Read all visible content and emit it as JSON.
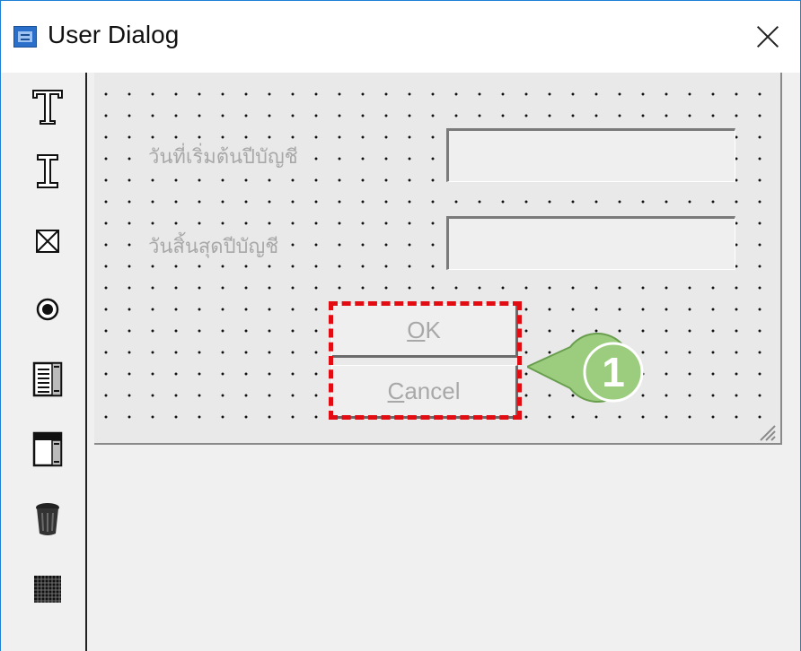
{
  "window": {
    "title": "User Dialog",
    "icon": "dialog-editor-icon",
    "close_icon": "close-icon"
  },
  "toolbox": {
    "tools": [
      {
        "name": "text-tool-icon"
      },
      {
        "name": "textbox-tool-icon"
      },
      {
        "name": "checkbox-tool-icon"
      },
      {
        "name": "option-button-tool-icon"
      },
      {
        "name": "listbox-tool-icon"
      },
      {
        "name": "combobox-tool-icon"
      },
      {
        "name": "trash-icon"
      },
      {
        "name": "grid-tool-icon"
      }
    ]
  },
  "form": {
    "label_start_date": "วันที่เริ่มต้นปีบัญชี",
    "label_end_date": "วันสิ้นสุดปีบัญชี",
    "ok_prefix": "",
    "ok_underlined": "O",
    "ok_rest": "K",
    "cancel_underlined": "C",
    "cancel_rest": "ancel"
  },
  "annotation": {
    "callout_number": "1",
    "highlight_color": "#e30c12",
    "callout_color": "#9ccc7e"
  }
}
